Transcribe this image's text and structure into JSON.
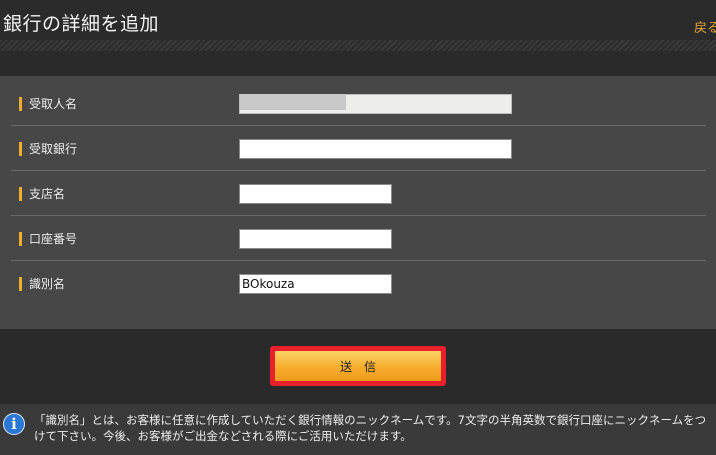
{
  "header": {
    "title": "銀行の詳細を追加",
    "back_label": "戻る"
  },
  "form": {
    "rows": [
      {
        "label": "受取人名",
        "value": ""
      },
      {
        "label": "受取銀行",
        "value": ""
      },
      {
        "label": "支店名",
        "value": ""
      },
      {
        "label": "口座番号",
        "value": ""
      },
      {
        "label": "識別名",
        "value": "BOkouza"
      }
    ]
  },
  "submit": {
    "label": "送信"
  },
  "info": {
    "icon": "info-icon",
    "text": "「識別名」とは、お客様に任意に作成していただく銀行情報のニックネームです。7文字の半角英数で銀行口座にニックネームをつけて下さい。今後、お客様がご出金などされる際にご活用いただけます。"
  },
  "colors": {
    "accent": "#f2ad2e",
    "highlight_border": "#e8202b",
    "info_blue": "#2b77d4"
  }
}
